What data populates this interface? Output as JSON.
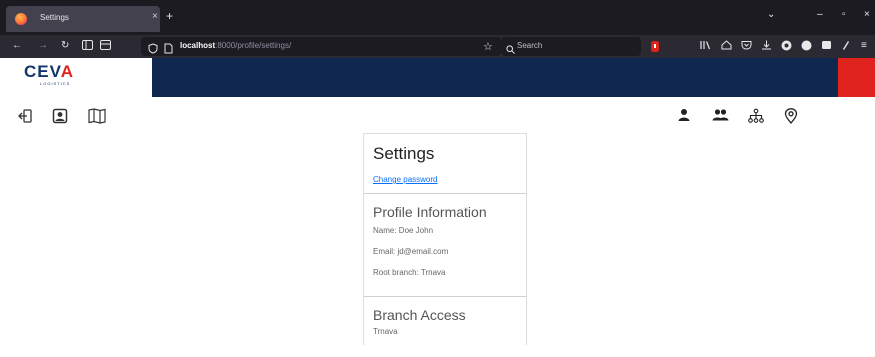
{
  "browser": {
    "tab_title": "Settings",
    "tab_close": "×",
    "new_tab": "+",
    "window_controls": [
      "⌄",
      "–",
      "▫",
      "×"
    ],
    "url_host": "localhost",
    "url_path": ":8000/profile/settings/",
    "search_placeholder": "Search"
  },
  "brand": {
    "logo_text_a": "CEV",
    "logo_text_b": "A",
    "logo_sub": "LOGISTICS",
    "banner_color": "#10274f",
    "accent_color": "#e0231c"
  },
  "toolbar": {
    "left_icons": [
      "logout-icon",
      "profile-icon",
      "map-icon"
    ],
    "right_icons": [
      "user-icon",
      "users-icon",
      "hierarchy-icon",
      "location-pin-icon"
    ]
  },
  "settings": {
    "title": "Settings",
    "change_password": "Change password"
  },
  "profile": {
    "heading": "Profile Information",
    "name": "Name: Doe John",
    "email": "Email: jd@email.com",
    "root_branch": "Root branch: Trnava"
  },
  "branch_access": {
    "heading": "Branch Access",
    "branches": [
      "Trnava"
    ]
  }
}
